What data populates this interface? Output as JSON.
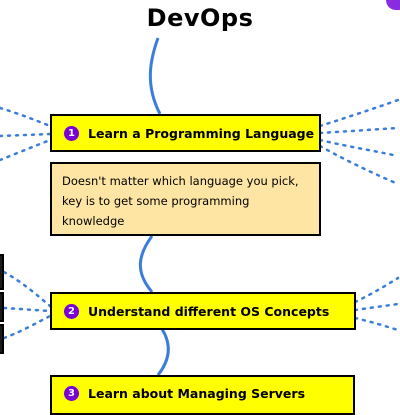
{
  "title": "DevOps",
  "steps": [
    {
      "number": "1",
      "label": "Learn a Programming Language"
    },
    {
      "number": "2",
      "label": "Understand different OS Concepts"
    },
    {
      "number": "3",
      "label": "Learn about Managing Servers"
    }
  ],
  "note": {
    "text": "Doesn't matter which language you pick, key is to get some programming knowledge"
  },
  "colors": {
    "node_fill": "#ffff00",
    "note_fill": "#ffe5a3",
    "spine": "#3a7ddb",
    "connector": "#3a7ddb",
    "badge": "#7b00d8"
  }
}
